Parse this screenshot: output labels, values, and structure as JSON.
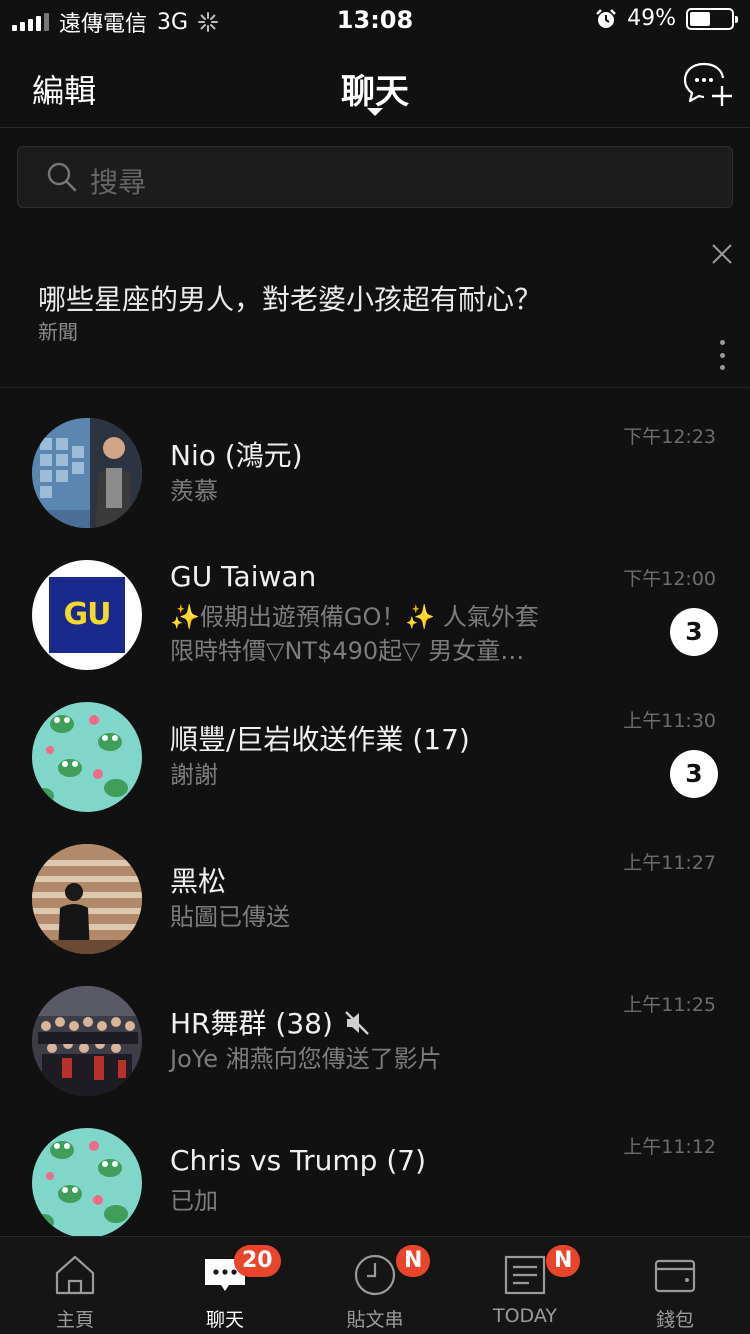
{
  "status_bar": {
    "carrier": "遠傳電信",
    "network": "3G",
    "time": "13:08",
    "battery": "49%",
    "battery_level": 0.49
  },
  "nav": {
    "edit_label": "編輯",
    "title": "聊天",
    "new_chat_icon": "new-chat-icon"
  },
  "search": {
    "placeholder": "搜尋"
  },
  "news": {
    "title": "哪些星座的男人，對老婆小孩超有耐心？",
    "source": "新聞"
  },
  "chats": [
    {
      "name": "Nio (鴻元)",
      "message": "羨慕",
      "time": "下午12:23"
    },
    {
      "name": "GU Taiwan",
      "message_line1": "✨假期出遊預備GO！✨ 人氣外套",
      "message_line2": "限時特價▽NT$490起▽ 男女童…",
      "time": "下午12:00",
      "unread": "3",
      "logo_text": "GU"
    },
    {
      "name": "順豐/巨岩收送作業 (17)",
      "message": "謝謝",
      "time": "上午11:30",
      "unread": "3"
    },
    {
      "name": "黑松",
      "message": "貼圖已傳送",
      "time": "上午11:27"
    },
    {
      "name": "HR舞群 (38)",
      "message": "JoYe 湘燕向您傳送了影片",
      "time": "上午11:25",
      "muted": true
    },
    {
      "name": "Chris vs Trump (7)",
      "message": "已加",
      "time": "上午11:12"
    }
  ],
  "tabs": [
    {
      "label": "主頁",
      "icon": "home-icon"
    },
    {
      "label": "聊天",
      "icon": "chat-icon",
      "badge": "20",
      "active": true
    },
    {
      "label": "貼文串",
      "icon": "clock-icon",
      "badge": "N"
    },
    {
      "label": "TODAY",
      "icon": "news-icon",
      "badge": "N"
    },
    {
      "label": "錢包",
      "icon": "wallet-icon"
    }
  ],
  "colors": {
    "background": "#111111",
    "badge_red": "#e8452c",
    "unread_bg": "#ffffff",
    "secondary_text": "#7c7c7c",
    "frog_avatar_bg": "#7fd6c9",
    "gu_logo_blue": "#1a2a8c",
    "gu_logo_yellow": "#f2d92b"
  }
}
